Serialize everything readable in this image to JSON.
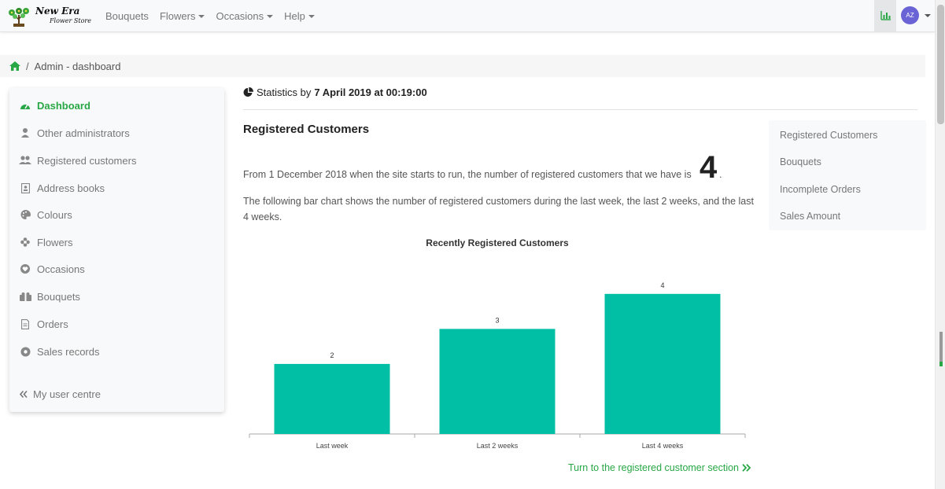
{
  "navbar": {
    "brand_title": "New Era",
    "brand_subtitle": "Flower Store",
    "links": [
      {
        "label": "Bouquets",
        "dropdown": false
      },
      {
        "label": "Flowers",
        "dropdown": true
      },
      {
        "label": "Occasions",
        "dropdown": true
      },
      {
        "label": "Help",
        "dropdown": true
      }
    ],
    "avatar_initials": "AZ"
  },
  "breadcrumb": {
    "separator": "/",
    "current": "Admin - dashboard"
  },
  "sidebar": {
    "items": [
      {
        "label": "Dashboard",
        "icon": "dashboard-icon"
      },
      {
        "label": "Other administrators",
        "icon": "user-icon"
      },
      {
        "label": "Registered customers",
        "icon": "users-icon"
      },
      {
        "label": "Address books",
        "icon": "address-book-icon"
      },
      {
        "label": "Colours",
        "icon": "palette-icon"
      },
      {
        "label": "Flowers",
        "icon": "flower-icon"
      },
      {
        "label": "Occasions",
        "icon": "heart-icon"
      },
      {
        "label": "Bouquets",
        "icon": "gift-icon"
      },
      {
        "label": "Orders",
        "icon": "document-icon"
      },
      {
        "label": "Sales records",
        "icon": "record-icon"
      }
    ],
    "user_centre": "My user centre"
  },
  "main": {
    "stats_prefix": "Statistics by",
    "stats_date": "7 April 2019 at 00:19:00",
    "section_title": "Registered Customers",
    "para1": "From 1 December 2018 when the site starts to run, the number of registered customers that we have is",
    "customer_count": "4",
    "period": ".",
    "para2": "The following bar chart shows the number of registered customers during the last week, the last 2 weeks, and the last 4 weeks.",
    "link_label": "Turn to the registered customer section"
  },
  "right_panel": {
    "items": [
      "Registered Customers",
      "Bouquets",
      "Incomplete Orders",
      "Sales Amount"
    ]
  },
  "chart_data": {
    "type": "bar",
    "title": "Recently Registered Customers",
    "categories": [
      "Last week",
      "Last 2 weeks",
      "Last 4 weeks"
    ],
    "values": [
      2,
      3,
      4
    ],
    "data_labels": [
      "2",
      "3",
      "4"
    ],
    "color": "#00bfa5",
    "ylim": [
      0,
      4.4
    ],
    "xlabel": "",
    "ylabel": "",
    "grid": false,
    "legend": "none"
  },
  "colors": {
    "accent": "#28a745",
    "bar": "#00bfa5",
    "avatar": "#6a63d6"
  }
}
